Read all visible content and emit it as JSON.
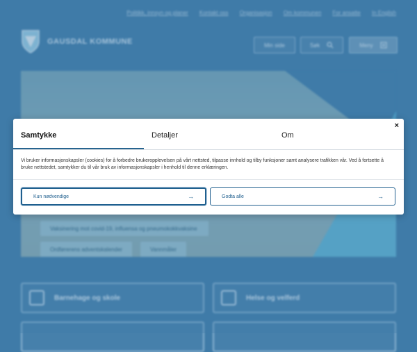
{
  "top_links": [
    "Politikk, innsyn og planer",
    "Kontakt oss",
    "Organisasjon",
    "Om kommunen",
    "For ansatte",
    "In English"
  ],
  "brand": {
    "name": "GAUSDAL KOMMUNE"
  },
  "header": {
    "min_side": "Min side",
    "search": "Søk",
    "menu": "Meny"
  },
  "chips": [
    "Vaksinering mot covid-19, influensa og pneumokokkvaksine",
    "Ordførerens adventskalender",
    "Vannmåler"
  ],
  "cards": [
    "Barnehage og skole",
    "Helse og velferd"
  ],
  "consent": {
    "tabs": [
      "Samtykke",
      "Detaljer",
      "Om"
    ],
    "close": "×",
    "message": "Vi bruker informasjonskapsler (cookies) for å forbedre brukeropplevelsen på vårt nettsted, tilpasse innhold og tilby funksjoner samt analysere trafikken vår. Ved å fortsette å bruke nettstedet, samtykker du til vår bruk av informasjonskapsler i henhold til denne erklæringen.",
    "necessary_label": "Kun nødvendige",
    "accept_all_label": "Godta alle",
    "arrow": "→"
  }
}
